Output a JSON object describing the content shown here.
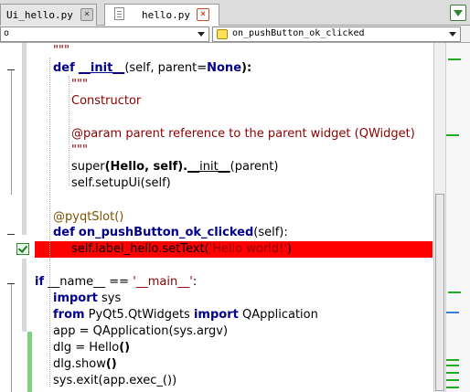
{
  "tabs": [
    {
      "label": "Ui_hello.py",
      "close": "×",
      "active": false
    },
    {
      "label": "hello.py",
      "close": "×",
      "active": true
    }
  ],
  "tab_menu_icon": "chevron-down-icon",
  "selectors": {
    "class_value": "o",
    "method_value": "on_pushButton_ok_clicked",
    "method_icon": "function-icon"
  },
  "code": {
    "l1": "\"\"\"",
    "l2_kw": "def",
    "l2_fn": "__init__",
    "l2_rest": "(self, parent=",
    "l2_none": "None",
    "l2_end": "):",
    "l3": "\"\"\"",
    "l4": "Constructor",
    "l5": "",
    "l6": "@param parent reference to the parent widget (QWidget)",
    "l7": "\"\"\"",
    "l8_a": "super",
    "l8_b": "(Hello, self).",
    "l8_c": "__init__",
    "l8_d": "(parent)",
    "l9_a": "self.setupUi",
    "l9_b": "(self)",
    "l10": "",
    "l11": "@pyqtSlot()",
    "l12_kw": "def",
    "l12_fn": "on_pushButton_ok_clicked",
    "l12_rest": "(self):",
    "l13_a": "self.label_hello.setText(",
    "l13_str": "'Hello world!'",
    "l13_end": ")",
    "l14": "",
    "l15_kw": "if",
    "l15_a": " __name__ == ",
    "l15_str": "'__main__'",
    "l15_end": ":",
    "l16_kw": "import",
    "l16_rest": " sys",
    "l17_kw": "from",
    "l17_mid": " PyQt5.QtWidgets ",
    "l17_kw2": "import",
    "l17_rest": " QApplication",
    "l18": "app = QApplication(sys.argv)",
    "l19_a": "dlg = Hello",
    "l19_b": "()",
    "l20_a": "dlg.show",
    "l20_b": "()",
    "l21": "sys.exit(app.exec_())"
  },
  "colors": {
    "highlight_line": "#ff0000",
    "keyword": "#00008b",
    "string": "#8b0000",
    "decorator": "#805000",
    "change_marker": "#22aa22",
    "search_marker": "#3a7fd0"
  }
}
